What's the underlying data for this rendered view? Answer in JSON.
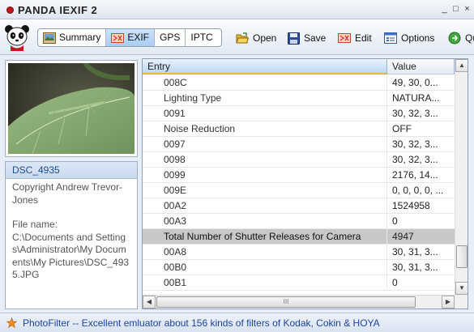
{
  "app": {
    "title": "PANDA IEXIF 2",
    "window_controls": {
      "minimize": "_",
      "maximize": "□",
      "close": "×"
    }
  },
  "toolbar": {
    "tabs": [
      {
        "label": "Summary",
        "icon": "summary-icon",
        "active": false
      },
      {
        "label": "EXIF",
        "icon": "exif-icon",
        "active": true
      },
      {
        "label": "GPS",
        "active": false
      },
      {
        "label": "IPTC",
        "active": false
      }
    ],
    "open_label": "Open",
    "save_label": "Save",
    "edit_label": "Edit",
    "options_label": "Options",
    "quit_label": "Qu"
  },
  "photo": {
    "name": "DSC_4935",
    "copyright": "Copyright Andrew Trevor-Jones",
    "file_label": "File name:",
    "file_path": "C:\\Documents and Settings\\Administrator\\My Documents\\My Pictures\\DSC_4935.JPG"
  },
  "grid": {
    "columns": {
      "entry": "Entry",
      "value": "Value"
    },
    "rows": [
      {
        "entry": "008C",
        "value": "49, 30, 0..."
      },
      {
        "entry": "Lighting Type",
        "value": "NATURA..."
      },
      {
        "entry": "0091",
        "value": "30, 32, 3..."
      },
      {
        "entry": "Noise Reduction",
        "value": "OFF"
      },
      {
        "entry": "0097",
        "value": "30, 32, 3..."
      },
      {
        "entry": "0098",
        "value": "30, 32, 3..."
      },
      {
        "entry": "0099",
        "value": "2176, 14..."
      },
      {
        "entry": "009E",
        "value": "0, 0, 0, 0, ..."
      },
      {
        "entry": "00A2",
        "value": "1524958"
      },
      {
        "entry": "00A3",
        "value": "0"
      },
      {
        "entry": "Total Number of Shutter Releases for Camera",
        "value": "4947",
        "selected": true
      },
      {
        "entry": "00A8",
        "value": "30, 31, 3..."
      },
      {
        "entry": "00B0",
        "value": "30, 31, 3..."
      },
      {
        "entry": "00B1",
        "value": "0"
      }
    ],
    "hscroll_grip": "III"
  },
  "status": {
    "text": "PhotoFilter -- Excellent emluator about 156 kinds of filters of Kodak, Cokin & HOYA"
  },
  "colors": {
    "accent": "#1c43a8",
    "selected_row": "#c8c8c8",
    "header_highlight": "#f0b63c",
    "brand_red": "#c4161c"
  }
}
